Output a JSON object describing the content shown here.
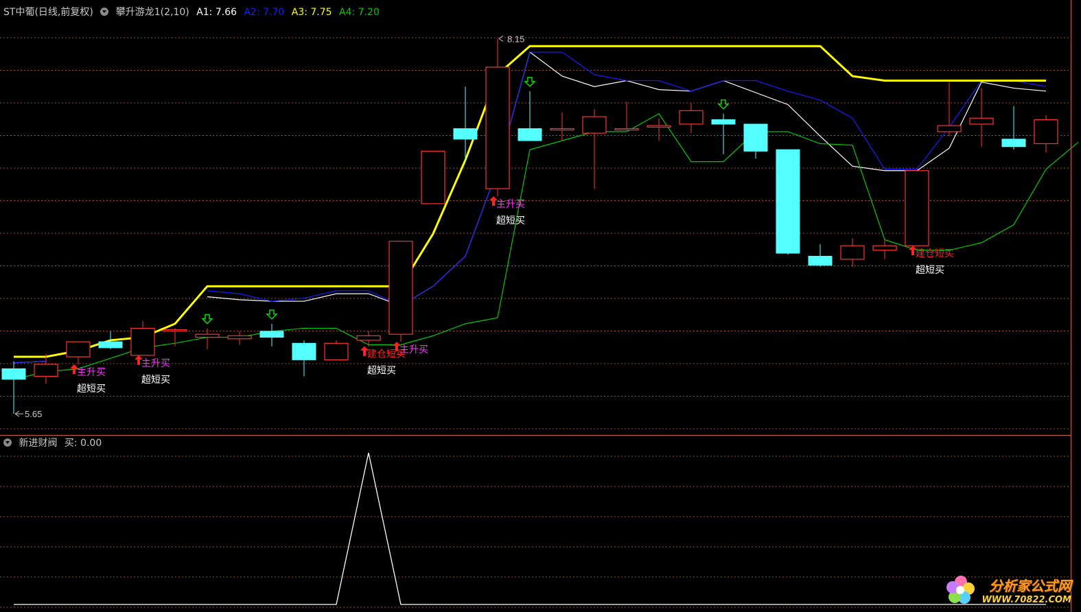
{
  "header": {
    "security": "ST中葡(日线,前复权)",
    "indicator": "攀升游龙1(2,10)",
    "a1_label": "A1: 7.66",
    "a2_label": "A2: 7.70",
    "a3_label": "A3: 7.75",
    "a4_label": "A4: 7.20"
  },
  "sub_header": {
    "indicator": "新进财阀",
    "value_label": "买: 0.00"
  },
  "colors": {
    "background": "#000000",
    "up": "#ff3232",
    "down": "#54ffff",
    "a1": "#ffffff",
    "a2": "#1a1aff",
    "a3": "#ffff00",
    "a4": "#00cc00",
    "signal_magenta": "#ff33ff",
    "signal_red": "#ff2020",
    "grid": "#a0522d"
  },
  "logo": {
    "line1": "分析家公式网",
    "line2": "WWW.70822.COM"
  },
  "chart_data": [
    {
      "type": "candlestick",
      "title": "攀升游龙1(2,10)",
      "ylim": [
        5.55,
        8.27
      ],
      "max_label": "8.15",
      "min_label": "5.65",
      "candles": [
        {
          "o": 5.95,
          "h": 6.0,
          "l": 5.65,
          "c": 5.88
        },
        {
          "o": 5.9,
          "h": 6.05,
          "l": 5.85,
          "c": 5.98
        },
        {
          "o": 6.03,
          "h": 6.1,
          "l": 5.98,
          "c": 6.13
        },
        {
          "o": 6.13,
          "h": 6.2,
          "l": 6.08,
          "c": 6.09
        },
        {
          "o": 6.04,
          "h": 6.27,
          "l": 6.04,
          "c": 6.22
        },
        {
          "o": 6.2,
          "h": 6.22,
          "l": 6.1,
          "c": 6.21
        },
        {
          "o": 6.16,
          "h": 6.22,
          "l": 6.08,
          "c": 6.18
        },
        {
          "o": 6.15,
          "h": 6.2,
          "l": 6.11,
          "c": 6.17
        },
        {
          "o": 6.2,
          "h": 6.25,
          "l": 6.1,
          "c": 6.16
        },
        {
          "o": 6.12,
          "h": 6.14,
          "l": 5.9,
          "c": 6.01
        },
        {
          "o": 6.01,
          "h": 6.14,
          "l": 6.01,
          "c": 6.12
        },
        {
          "o": 6.14,
          "h": 6.2,
          "l": 6.1,
          "c": 6.17
        },
        {
          "o": 6.18,
          "h": 6.8,
          "l": 6.13,
          "c": 6.8
        },
        {
          "o": 7.05,
          "h": 7.4,
          "l": 7.08,
          "c": 7.4
        },
        {
          "o": 7.55,
          "h": 7.83,
          "l": 7.33,
          "c": 7.48
        },
        {
          "o": 7.15,
          "h": 8.15,
          "l": 7.1,
          "c": 7.96
        },
        {
          "o": 7.55,
          "h": 7.8,
          "l": 7.47,
          "c": 7.47
        },
        {
          "o": 7.55,
          "h": 7.66,
          "l": 7.47,
          "c": 7.55
        },
        {
          "o": 7.52,
          "h": 7.68,
          "l": 7.15,
          "c": 7.63
        },
        {
          "o": 7.55,
          "h": 7.73,
          "l": 7.55,
          "c": 7.55
        },
        {
          "o": 7.56,
          "h": 7.62,
          "l": 7.47,
          "c": 7.57
        },
        {
          "o": 7.58,
          "h": 7.72,
          "l": 7.52,
          "c": 7.67
        },
        {
          "o": 7.61,
          "h": 7.65,
          "l": 7.38,
          "c": 7.58
        },
        {
          "o": 7.58,
          "h": 7.58,
          "l": 7.35,
          "c": 7.4
        },
        {
          "o": 7.41,
          "h": 7.41,
          "l": 6.71,
          "c": 6.72
        },
        {
          "o": 6.7,
          "h": 6.78,
          "l": 6.63,
          "c": 6.64
        },
        {
          "o": 6.68,
          "h": 6.82,
          "l": 6.63,
          "c": 6.77
        },
        {
          "o": 6.74,
          "h": 6.82,
          "l": 6.68,
          "c": 6.77
        },
        {
          "o": 6.77,
          "h": 7.27,
          "l": 6.77,
          "c": 7.27
        },
        {
          "o": 7.53,
          "h": 7.86,
          "l": 7.5,
          "c": 7.57
        },
        {
          "o": 7.58,
          "h": 7.82,
          "l": 7.43,
          "c": 7.62
        },
        {
          "o": 7.48,
          "h": 7.7,
          "l": 7.41,
          "c": 7.43
        },
        {
          "o": 7.45,
          "h": 7.64,
          "l": 7.39,
          "c": 7.61
        }
      ],
      "series": [
        {
          "name": "A1",
          "values": [
            5.99,
            6.0,
            null,
            null,
            null,
            null,
            6.43,
            6.41,
            6.4,
            6.4,
            6.45,
            6.45,
            6.37,
            6.5,
            6.7,
            7.28,
            8.06,
            7.9,
            7.83,
            7.87,
            7.81,
            7.8,
            7.87,
            7.79,
            7.71,
            7.5,
            7.3,
            7.27,
            7.27,
            7.42,
            7.86,
            7.82,
            7.8
          ]
        },
        {
          "name": "A2",
          "values": [
            5.99,
            6.0,
            null,
            null,
            null,
            null,
            6.47,
            6.45,
            6.4,
            6.42,
            6.47,
            6.47,
            6.37,
            6.5,
            6.7,
            7.28,
            8.06,
            8.06,
            7.91,
            7.87,
            7.87,
            7.8,
            7.87,
            7.87,
            7.8,
            7.74,
            7.62,
            7.28,
            7.28,
            7.56,
            7.87,
            7.87,
            7.83
          ]
        },
        {
          "name": "A3",
          "values": [
            6.03,
            6.03,
            6.07,
            6.14,
            6.16,
            6.25,
            6.5,
            6.5,
            6.5,
            6.5,
            6.5,
            6.5,
            6.5,
            6.85,
            7.34,
            7.91,
            8.1,
            8.1,
            8.1,
            8.1,
            8.1,
            8.1,
            8.1,
            8.1,
            8.1,
            8.1,
            7.9,
            7.87,
            7.87,
            7.87,
            7.87,
            7.87,
            7.87
          ]
        },
        {
          "name": "A4",
          "values": [
            5.88,
            5.93,
            5.95,
            6.02,
            6.09,
            6.12,
            6.16,
            6.16,
            6.2,
            6.22,
            6.22,
            6.11,
            6.11,
            6.17,
            6.25,
            6.29,
            7.41,
            7.47,
            7.53,
            7.53,
            7.65,
            7.33,
            7.33,
            7.53,
            7.53,
            7.45,
            7.44,
            6.81,
            6.74,
            6.74,
            6.79,
            6.91,
            7.28,
            7.46
          ]
        }
      ],
      "signals": [
        {
          "bar": 2,
          "label": "主升买",
          "color": "magenta"
        },
        {
          "bar": 2,
          "label": "超短买",
          "color": "white"
        },
        {
          "bar": 4,
          "label": "主升买",
          "color": "magenta"
        },
        {
          "bar": 4,
          "label": "超短买",
          "color": "white"
        },
        {
          "bar": 11,
          "label": "建仓短买",
          "color": "red"
        },
        {
          "bar": 11,
          "label": "超短买",
          "color": "white"
        },
        {
          "bar": 12,
          "label": "主升买",
          "color": "magenta"
        },
        {
          "bar": 15,
          "label": "主升买",
          "color": "magenta"
        },
        {
          "bar": 15,
          "label": "超短买",
          "color": "white"
        },
        {
          "bar": 28,
          "label": "建仓短买",
          "color": "red"
        },
        {
          "bar": 28,
          "label": "超短买",
          "color": "white"
        }
      ],
      "down_arrows": [
        6,
        8,
        16,
        22
      ]
    },
    {
      "type": "line",
      "title": "新进财阀",
      "ylim": [
        0,
        1
      ],
      "series": [
        {
          "name": "买",
          "values": [
            0,
            0,
            0,
            0,
            0,
            0,
            0,
            0,
            0,
            0,
            0,
            1,
            0,
            0,
            0,
            0,
            0,
            0,
            0,
            0,
            0,
            0,
            0,
            0,
            0,
            0,
            0,
            0,
            0,
            0,
            0,
            0,
            0
          ]
        }
      ]
    }
  ]
}
